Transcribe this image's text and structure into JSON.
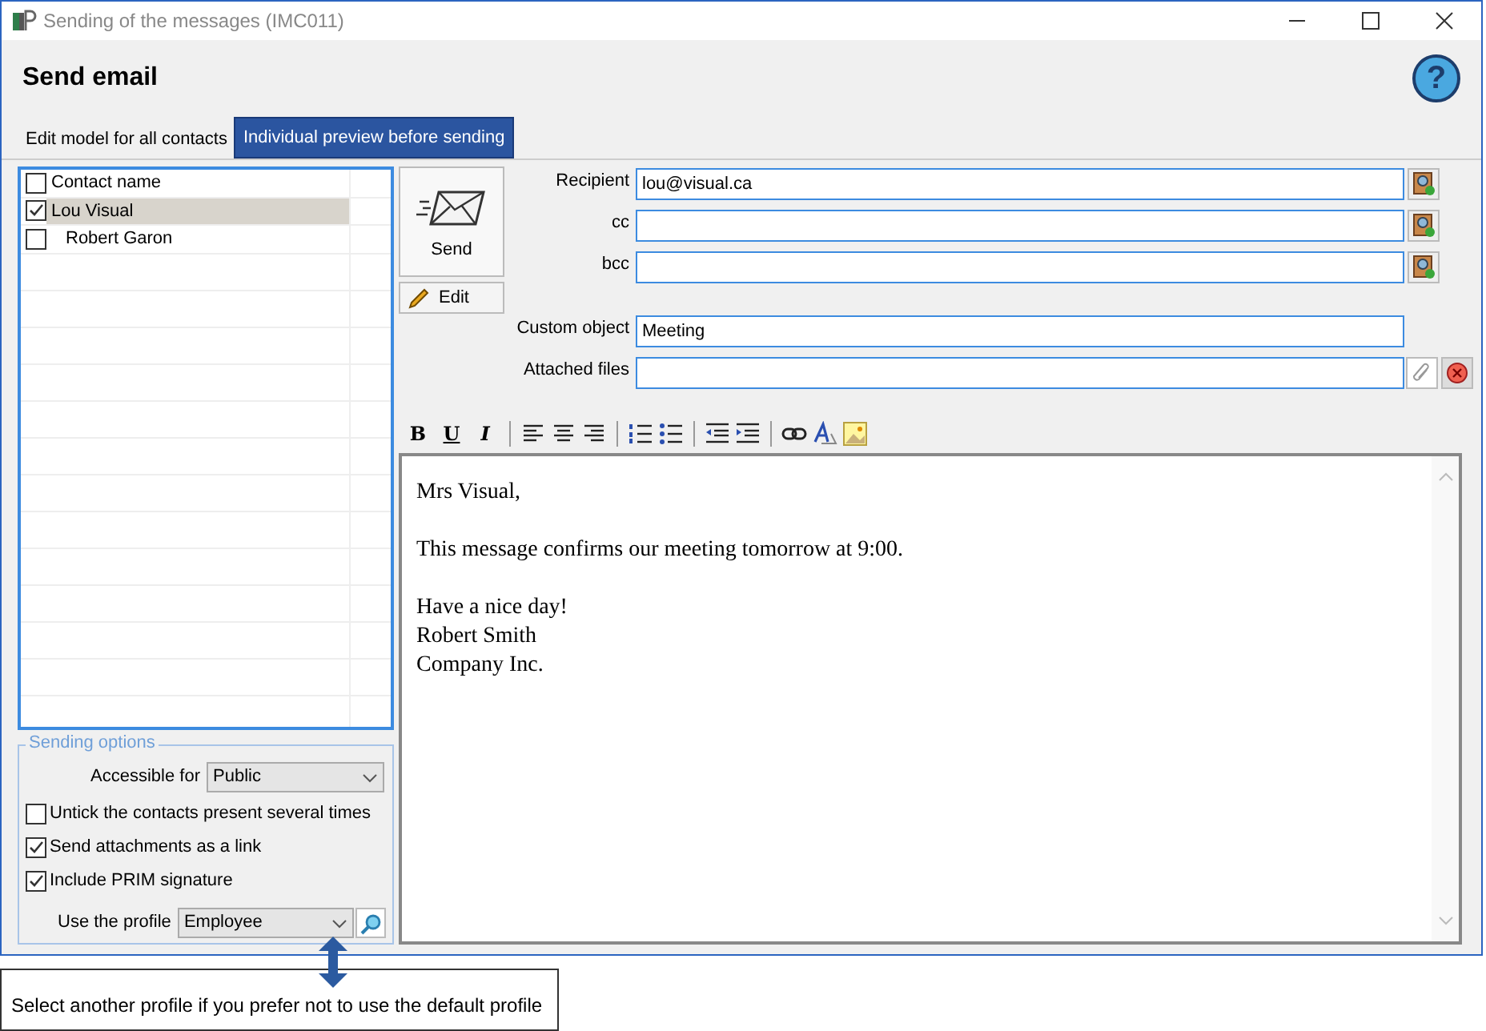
{
  "window": {
    "title": "Sending of the messages (IMC011)"
  },
  "heading": "Send email",
  "help_button": "?",
  "tabs": [
    {
      "label": "Edit model for all contacts",
      "selected": false
    },
    {
      "label": "Individual preview before sending",
      "selected": true
    }
  ],
  "contacts": {
    "header": {
      "label": "Contact name",
      "checked": false
    },
    "rows": [
      {
        "name": "Lou Visual",
        "checked": true,
        "selected": true
      },
      {
        "name": "Robert Garon",
        "checked": false,
        "selected": false
      }
    ]
  },
  "send_button": "Send",
  "edit_button": "Edit",
  "fields": [
    {
      "label": "Recipient",
      "value": "lou@visual.ca",
      "kind": "address"
    },
    {
      "label": "cc",
      "kind": "address"
    },
    {
      "label": "bcc",
      "kind": "address"
    },
    {
      "label": "Custom object",
      "value": "Meeting",
      "kind": "text"
    },
    {
      "label": "Attached files",
      "kind": "files"
    }
  ],
  "toolbar": [
    {
      "kind": "bold",
      "label": "B"
    },
    {
      "kind": "underline",
      "label": "U"
    },
    {
      "kind": "italic",
      "label": "I"
    },
    {
      "kind": "sep"
    },
    {
      "kind": "align-left"
    },
    {
      "kind": "align-center"
    },
    {
      "kind": "align-right"
    },
    {
      "kind": "sep"
    },
    {
      "kind": "numbered-list"
    },
    {
      "kind": "bullet-list"
    },
    {
      "kind": "sep"
    },
    {
      "kind": "outdent"
    },
    {
      "kind": "indent"
    },
    {
      "kind": "sep"
    },
    {
      "kind": "link"
    },
    {
      "kind": "font"
    },
    {
      "kind": "image"
    }
  ],
  "message": [
    [
      "Mrs Visual,"
    ],
    [
      "This message confirms our meeting tomorrow at 9:00."
    ],
    [
      "Have a nice day!",
      "Robert Smith",
      "Company Inc."
    ]
  ],
  "sending_options": {
    "title": "Sending options",
    "accessible_for": {
      "label": "Accessible for",
      "value": "Public"
    },
    "checkboxes": [
      {
        "label": "Untick the contacts present several times",
        "checked": false
      },
      {
        "label": "Send attachments as a link",
        "checked": true
      },
      {
        "label": "Include PRIM signature",
        "checked": true
      }
    ],
    "profile": {
      "label": "Use the profile",
      "value": "Employee"
    }
  },
  "callout": "Select another profile if you prefer not to use the default profile"
}
